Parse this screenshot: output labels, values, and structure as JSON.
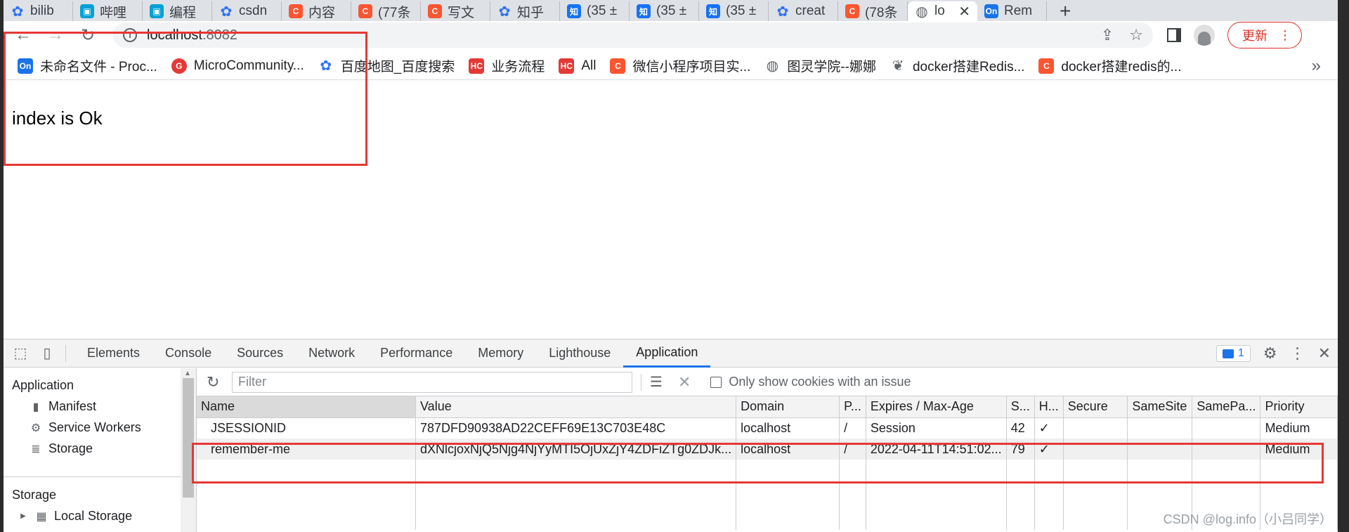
{
  "tabs": [
    {
      "label": "bilib",
      "favicon": "paw",
      "color": "#3072f6"
    },
    {
      "label": "哔哩",
      "favicon": "tv",
      "color": "#00a1d6"
    },
    {
      "label": "编程",
      "favicon": "tv",
      "color": "#00a1d6"
    },
    {
      "label": "csdn",
      "favicon": "paw",
      "color": "#3072f6"
    },
    {
      "label": "内容",
      "favicon": "C",
      "color": "#fc5531"
    },
    {
      "label": "(77条",
      "favicon": "C",
      "color": "#fc5531"
    },
    {
      "label": "写文",
      "favicon": "C",
      "color": "#fc5531"
    },
    {
      "label": "知乎",
      "favicon": "paw",
      "color": "#3072f6"
    },
    {
      "label": "(35 ±",
      "favicon": "知",
      "color": "#1772f6"
    },
    {
      "label": "(35 ±",
      "favicon": "知",
      "color": "#1772f6"
    },
    {
      "label": "(35 ±",
      "favicon": "知",
      "color": "#1772f6"
    },
    {
      "label": "creat",
      "favicon": "paw",
      "color": "#3072f6"
    },
    {
      "label": "(78条",
      "favicon": "C",
      "color": "#fc5531"
    },
    {
      "label": "lo",
      "favicon": "globe",
      "color": "#5f6368",
      "active": true
    },
    {
      "label": "Rem",
      "favicon": "On",
      "color": "#1a73e8"
    }
  ],
  "address": {
    "host": "localhost",
    "port": ":8082",
    "update_label": "更新"
  },
  "bookmarks": [
    {
      "label": "未命名文件 - Proc...",
      "favicon": "On",
      "color": "#1a73e8"
    },
    {
      "label": "MicroCommunity...",
      "favicon": "G",
      "color": "#e53935"
    },
    {
      "label": "百度地图_百度搜索",
      "favicon": "paw",
      "color": "#3072f6"
    },
    {
      "label": "业务流程",
      "favicon": "HC",
      "color": "#e53935"
    },
    {
      "label": "All",
      "favicon": "HC",
      "color": "#e53935"
    },
    {
      "label": "微信小程序项目实...",
      "favicon": "C",
      "color": "#fc5531"
    },
    {
      "label": "图灵学院--娜娜",
      "favicon": "globe",
      "color": "#5f6368"
    },
    {
      "label": "docker搭建Redis...",
      "favicon": "leaf",
      "color": "#5f6368"
    },
    {
      "label": "docker搭建redis的...",
      "favicon": "C",
      "color": "#fc5531"
    }
  ],
  "page": {
    "text": "index is Ok"
  },
  "devtools": {
    "tabs": [
      "Elements",
      "Console",
      "Sources",
      "Network",
      "Performance",
      "Memory",
      "Lighthouse",
      "Application"
    ],
    "active_tab": "Application",
    "issues_count": "1",
    "sidebar": {
      "application_heading": "Application",
      "application_items": [
        {
          "label": "Manifest",
          "icon": "file-icon"
        },
        {
          "label": "Service Workers",
          "icon": "gear-icon"
        },
        {
          "label": "Storage",
          "icon": "database-icon"
        }
      ],
      "storage_heading": "Storage",
      "storage_items": [
        {
          "label": "Local Storage",
          "icon": "grid-icon"
        }
      ]
    },
    "filter": {
      "placeholder": "Filter",
      "issue_checkbox_label": "Only show cookies with an issue"
    },
    "columns": [
      "Name",
      "Value",
      "Domain",
      "P...",
      "Expires / Max-Age",
      "S...",
      "H...",
      "Secure",
      "SameSite",
      "SamePa...",
      "Priority"
    ],
    "rows": [
      [
        "JSESSIONID",
        "787DFD90938AD22CEFF69E13C703E48C",
        "localhost",
        "/",
        "Session",
        "42",
        "✓",
        "",
        "",
        "",
        "Medium"
      ],
      [
        "remember-me",
        "dXNlcjoxNjQ5Njg4NjYyMTI5OjUxZjY4ZDFiZTg0ZDJk...",
        "localhost",
        "/",
        "2022-04-11T14:51:02...",
        "79",
        "✓",
        "",
        "",
        "",
        "Medium"
      ]
    ]
  },
  "watermark": "CSDN @log.info（小吕同学）",
  "colors": {
    "highlight_red": "#e53935",
    "accent_blue": "#1a73e8"
  }
}
